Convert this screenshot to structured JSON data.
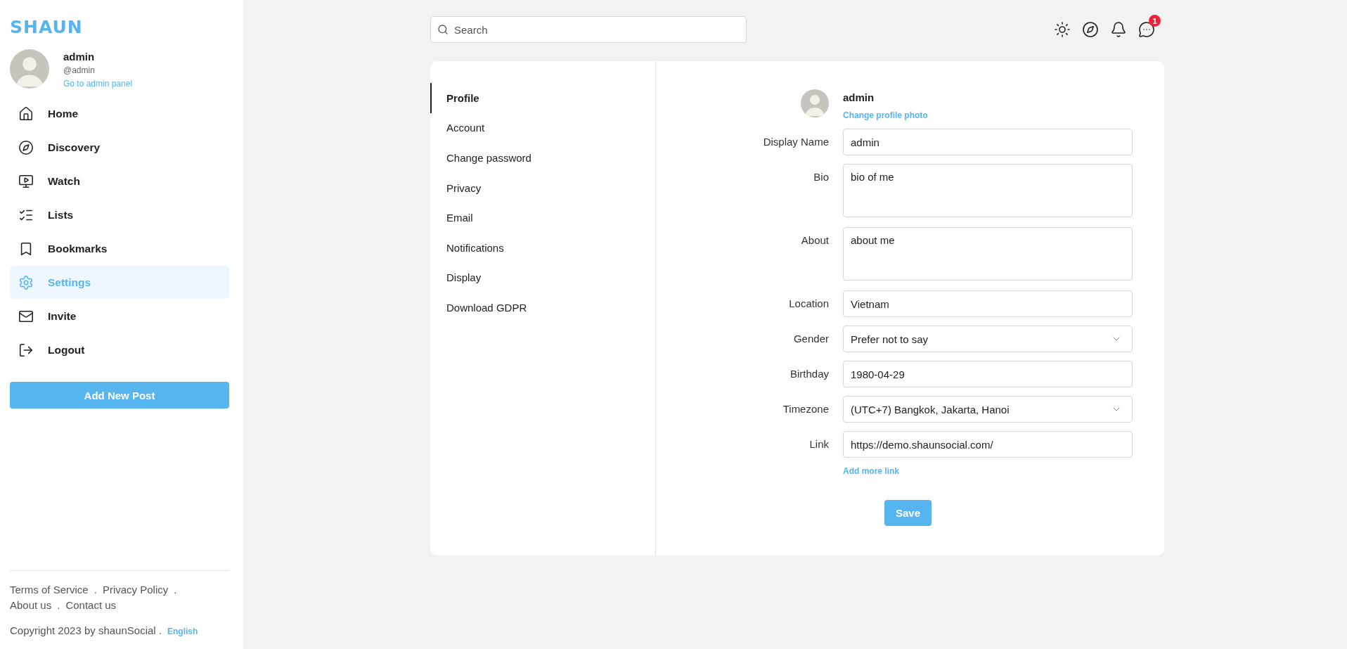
{
  "logo": "SHAUN",
  "user": {
    "name": "admin",
    "handle": "@admin",
    "admin_link": "Go to admin panel"
  },
  "nav": [
    {
      "label": "Home",
      "kind": "home",
      "selected": false
    },
    {
      "label": "Discovery",
      "kind": "compass",
      "selected": false
    },
    {
      "label": "Watch",
      "kind": "watch",
      "selected": false
    },
    {
      "label": "Lists",
      "kind": "lists",
      "selected": false
    },
    {
      "label": "Bookmarks",
      "kind": "bookmark",
      "selected": false
    },
    {
      "label": "Settings",
      "kind": "settings",
      "selected": true
    },
    {
      "label": "Invite",
      "kind": "mail",
      "selected": false
    },
    {
      "label": "Logout",
      "kind": "logout",
      "selected": false
    }
  ],
  "add_post": "Add New Post",
  "footer": {
    "link_rows": [
      [
        {
          "label": "Terms of Service",
          "separator": "."
        },
        {
          "label": "Privacy Policy",
          "separator": "."
        }
      ],
      [
        {
          "label": "About us",
          "separator": "."
        },
        {
          "label": "Contact us"
        }
      ]
    ],
    "copyright": "Copyright 2023 by shaunSocial .",
    "language": "English"
  },
  "search": {
    "placeholder": "Search"
  },
  "header": {
    "chat_badge": "1"
  },
  "settings_menu": [
    {
      "label": "Profile",
      "selected": true
    },
    {
      "label": "Account",
      "selected": false
    },
    {
      "label": "Change password",
      "selected": false
    },
    {
      "label": "Privacy",
      "selected": false
    },
    {
      "label": "Email",
      "selected": false
    },
    {
      "label": "Notifications",
      "selected": false
    },
    {
      "label": "Display",
      "selected": false
    },
    {
      "label": "Download GDPR",
      "selected": false
    }
  ],
  "profile": {
    "name": "admin",
    "change_photo": "Change profile photo",
    "fields": [
      {
        "label": "Display Name",
        "kind": "input",
        "value": "admin"
      },
      {
        "label": "Bio",
        "kind": "textarea",
        "value": "bio of me"
      },
      {
        "label": "About",
        "kind": "textarea",
        "value": "about me"
      },
      {
        "label": "Location",
        "kind": "input",
        "value": "Vietnam"
      },
      {
        "label": "Gender",
        "kind": "select",
        "value": "Prefer not to say"
      },
      {
        "label": "Birthday",
        "kind": "input",
        "value": "1980-04-29"
      },
      {
        "label": "Timezone",
        "kind": "select",
        "value": "(UTC+7) Bangkok, Jakarta, Hanoi"
      },
      {
        "label": "Link",
        "kind": "input",
        "value": "https://demo.shaunsocial.com/"
      }
    ],
    "add_link": "Add more link",
    "save": "Save"
  }
}
